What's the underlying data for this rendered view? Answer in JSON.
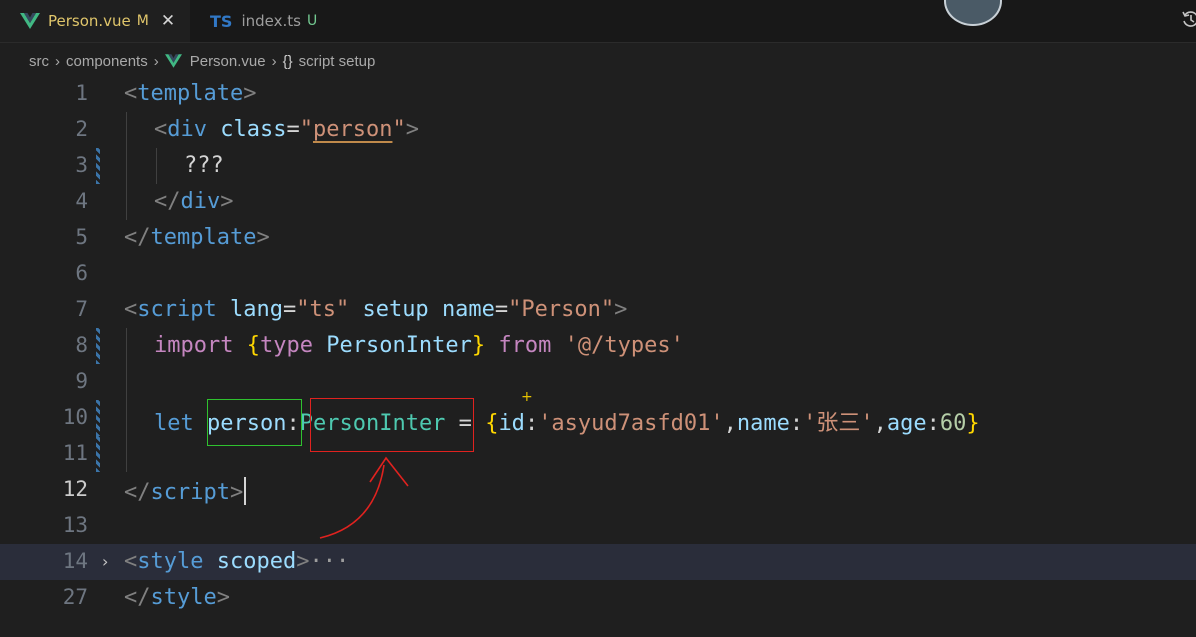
{
  "tabs": [
    {
      "label": "Person.vue",
      "status": "M",
      "icon": "vue-icon",
      "active": true
    },
    {
      "label": "index.ts",
      "status": "U",
      "icon": "typescript-icon",
      "icon_text": "TS",
      "active": false
    }
  ],
  "breadcrumb": {
    "items": [
      "src",
      "components",
      "Person.vue",
      "script setup"
    ],
    "braces": "{}"
  },
  "editor": {
    "current_line": 12,
    "lines": [
      {
        "n": "1",
        "tokens": [
          "<",
          "template",
          ">"
        ]
      },
      {
        "n": "2",
        "tokens": [
          "<",
          "div",
          " ",
          "class",
          "=",
          "\"",
          "person",
          "\"",
          ">"
        ]
      },
      {
        "n": "3",
        "tokens": [
          "???"
        ]
      },
      {
        "n": "4",
        "tokens": [
          "</",
          "div",
          ">"
        ]
      },
      {
        "n": "5",
        "tokens": [
          "</",
          "template",
          ">"
        ]
      },
      {
        "n": "6",
        "tokens": []
      },
      {
        "n": "7",
        "tokens": [
          "<",
          "script",
          " ",
          "lang",
          "=",
          "\"ts\"",
          " ",
          "setup",
          " ",
          "name",
          "=",
          "\"Person\"",
          ">"
        ]
      },
      {
        "n": "8",
        "tokens": [
          "import",
          " ",
          "{",
          "type",
          " ",
          "PersonInter",
          "}",
          " ",
          "from",
          " ",
          "'@/types'"
        ]
      },
      {
        "n": "9",
        "tokens": []
      },
      {
        "n": "10",
        "tokens": [
          "let",
          " ",
          "person",
          ":",
          "PersonInter",
          " = ",
          "{",
          "id",
          ":",
          "'asyud7asfd01'",
          ",",
          "name",
          ":",
          "'张三'",
          ",",
          "age",
          ":",
          "60",
          "}"
        ]
      },
      {
        "n": "11",
        "tokens": []
      },
      {
        "n": "12",
        "tokens": [
          "</",
          "script",
          ">"
        ]
      },
      {
        "n": "13",
        "tokens": []
      },
      {
        "n": "14",
        "tokens": [
          "<",
          "style",
          " ",
          "scoped",
          ">",
          "···"
        ]
      },
      {
        "n": "27",
        "tokens": [
          "</",
          "style",
          ">"
        ]
      }
    ]
  },
  "annotations": {
    "green_box": "person",
    "red_box": "PersonInter",
    "plus_marker": "+"
  },
  "colors": {
    "background": "#1f1f1f",
    "tag": "#569cd6",
    "attribute": "#9cdcfe",
    "string": "#ce9178",
    "keyword": "#c586c0",
    "type": "#4ec9b0",
    "number": "#b5cea8",
    "brace": "#ffd700",
    "annotation_green": "#2fc12f",
    "annotation_red": "#e0221f"
  }
}
